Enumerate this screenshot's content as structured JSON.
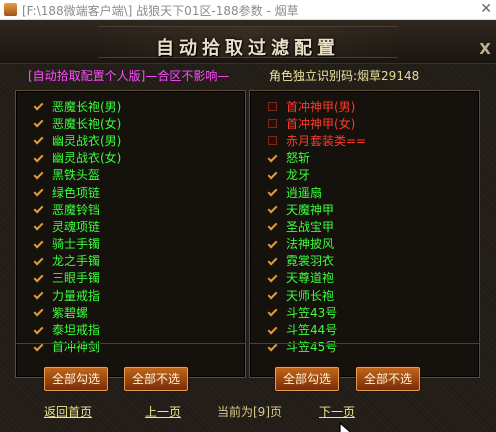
{
  "window": {
    "title": "[F:\\188微端客户端\\] 战狼天下01区-188参数 - 烟草"
  },
  "dialog": {
    "title": "自动拾取过滤配置",
    "close_glyph": "X",
    "profile_note": "[自动拾取配置个人版]—合区不影响—",
    "role_code_label": "角色独立识别码:",
    "role_code_value": "烟草29148"
  },
  "left_panel": {
    "items": [
      {
        "label": "恶魔长袍(男)",
        "checked": true,
        "color": "#3aff3a"
      },
      {
        "label": "恶魔长袍(女)",
        "checked": true,
        "color": "#3aff3a"
      },
      {
        "label": "幽灵战衣(男)",
        "checked": true,
        "color": "#3aff3a"
      },
      {
        "label": "幽灵战衣(女)",
        "checked": true,
        "color": "#3aff3a"
      },
      {
        "label": "黑铁头盔",
        "checked": true,
        "color": "#3aff3a"
      },
      {
        "label": "绿色项链",
        "checked": true,
        "color": "#3aff3a"
      },
      {
        "label": "恶魔铃铛",
        "checked": true,
        "color": "#3aff3a"
      },
      {
        "label": "灵魂项链",
        "checked": true,
        "color": "#3aff3a"
      },
      {
        "label": "骑士手镯",
        "checked": true,
        "color": "#3aff3a"
      },
      {
        "label": "龙之手镯",
        "checked": true,
        "color": "#3aff3a"
      },
      {
        "label": "三眼手镯",
        "checked": true,
        "color": "#3aff3a"
      },
      {
        "label": "力量戒指",
        "checked": true,
        "color": "#3aff3a"
      },
      {
        "label": "紫碧螺",
        "checked": true,
        "color": "#3aff3a"
      },
      {
        "label": "泰坦戒指",
        "checked": true,
        "color": "#3aff3a"
      },
      {
        "label": "首冲神剑",
        "checked": true,
        "color": "#3aff3a"
      }
    ],
    "select_all": "全部勾选",
    "select_none": "全部不选"
  },
  "right_panel": {
    "items": [
      {
        "label": "首冲神甲(男)",
        "checked": false,
        "color": "#ff3a2a"
      },
      {
        "label": "首冲神甲(女)",
        "checked": false,
        "color": "#ff3a2a"
      },
      {
        "label": "赤月套装类==",
        "checked": false,
        "color": "#ff3a2a"
      },
      {
        "label": "怒斩",
        "checked": true,
        "color": "#3aff3a"
      },
      {
        "label": "龙牙",
        "checked": true,
        "color": "#3aff3a"
      },
      {
        "label": "逍遥扇",
        "checked": true,
        "color": "#3aff3a"
      },
      {
        "label": "天魔神甲",
        "checked": true,
        "color": "#3aff3a"
      },
      {
        "label": "圣战宝甲",
        "checked": true,
        "color": "#3aff3a"
      },
      {
        "label": "法神披风",
        "checked": true,
        "color": "#3aff3a"
      },
      {
        "label": "霓裳羽衣",
        "checked": true,
        "color": "#3aff3a"
      },
      {
        "label": "天尊道袍",
        "checked": true,
        "color": "#3aff3a"
      },
      {
        "label": "天师长袍",
        "checked": true,
        "color": "#3aff3a"
      },
      {
        "label": "斗笠43号",
        "checked": true,
        "color": "#3aff3a"
      },
      {
        "label": "斗笠44号",
        "checked": true,
        "color": "#3aff3a"
      },
      {
        "label": "斗笠45号",
        "checked": true,
        "color": "#3aff3a"
      }
    ],
    "select_all": "全部勾选",
    "select_none": "全部不选"
  },
  "footer": {
    "home": "返回首页",
    "prev": "上一页",
    "current": "当前为[9]页",
    "next": "下一页"
  },
  "colors": {
    "checked_item": "#3aff3a",
    "unchecked_item": "#ff3a2a",
    "profile_note": "#ff4dff",
    "button_fill": "#a84a12"
  }
}
